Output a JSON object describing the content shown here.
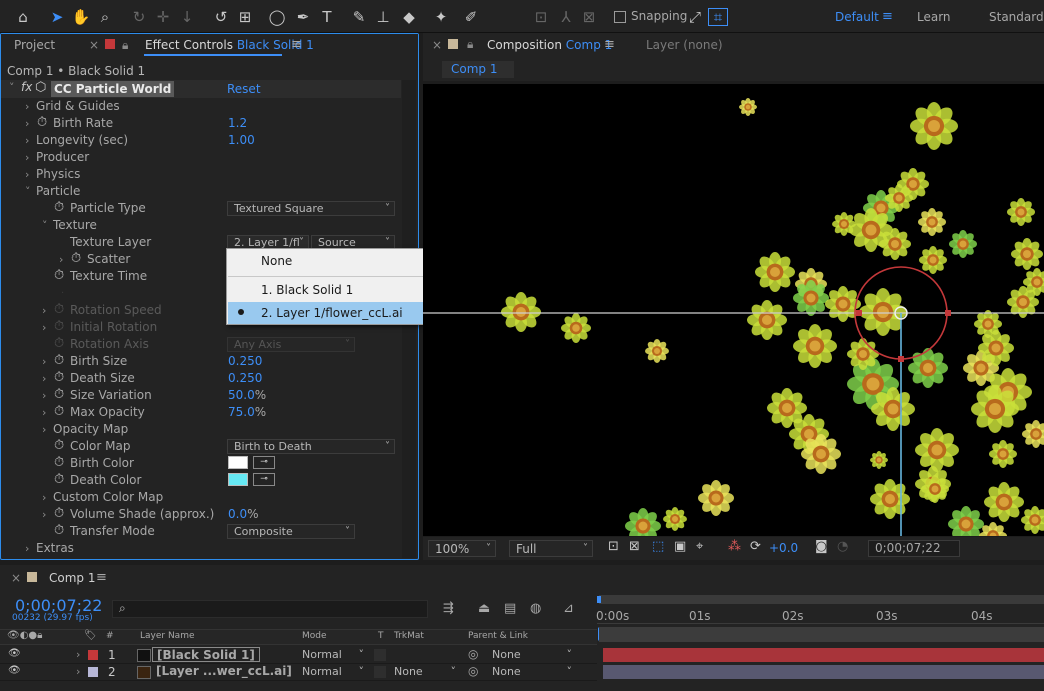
{
  "toolbar": {
    "snapping_label": "Snapping",
    "workspaces": [
      "Default",
      "Learn",
      "Standard"
    ]
  },
  "left_panel": {
    "project_tab": "Project",
    "effect_tab_prefix": "Effect Controls",
    "effect_tab_layer": "Black Solid 1",
    "breadcrumb": "Comp 1 • Black Solid 1",
    "effect_name": "CC Particle World",
    "reset_label": "Reset",
    "properties": [
      {
        "label": "Grid & Guides",
        "value": ""
      },
      {
        "label": "Birth Rate",
        "value": "1.2"
      },
      {
        "label": "Longevity (sec)",
        "value": "1.00"
      },
      {
        "label": "Producer",
        "value": ""
      },
      {
        "label": "Physics",
        "value": ""
      },
      {
        "label": "Particle",
        "value": ""
      },
      {
        "label": "Particle Type",
        "value": "Textured Square"
      },
      {
        "label": "Texture",
        "value": ""
      },
      {
        "label": "Texture Layer",
        "value": "2. Layer 1/fl",
        "value2": "Source"
      },
      {
        "label": "Scatter",
        "value": ""
      },
      {
        "label": "Texture Time",
        "value": ""
      },
      {
        "label": "Rotation Speed",
        "value": ""
      },
      {
        "label": "Initial Rotation",
        "value": ""
      },
      {
        "label": "Rotation Axis",
        "value": "Any Axis"
      },
      {
        "label": "Birth Size",
        "value": "0.250"
      },
      {
        "label": "Death Size",
        "value": "0.250"
      },
      {
        "label": "Size Variation",
        "value": "50.0",
        "unit": "%"
      },
      {
        "label": "Max Opacity",
        "value": "75.0",
        "unit": "%"
      },
      {
        "label": "Opacity Map",
        "value": ""
      },
      {
        "label": "Color Map",
        "value": "Birth to Death"
      },
      {
        "label": "Birth Color",
        "value": ""
      },
      {
        "label": "Death Color",
        "value": ""
      },
      {
        "label": "Custom Color Map",
        "value": ""
      },
      {
        "label": "Volume Shade (approx.)",
        "value": "0.0",
        "unit": "%"
      },
      {
        "label": "Transfer Mode",
        "value": "Composite"
      },
      {
        "label": "Extras",
        "value": ""
      }
    ],
    "colors": {
      "birth": "#ffffff",
      "death": "#66e9f4"
    }
  },
  "popup": {
    "items": [
      "None",
      "1. Black Solid 1",
      "2. Layer 1/flower_ccL.ai"
    ],
    "selected_index": 2
  },
  "composition": {
    "tab_prefix": "Composition",
    "tab_name": "Comp 1",
    "layer_tab": "Layer (none)",
    "subtab": "Comp 1",
    "zoom": "100%",
    "resolution": "Full",
    "exposure": "+0.0",
    "timecode": "0;00;07;22"
  },
  "timeline": {
    "tab": "Comp 1",
    "timecode": "0;00;07;22",
    "frames": "00232 (29.97 fps)",
    "search_placeholder": "",
    "ruler": [
      "0:00s",
      "01s",
      "02s",
      "03s",
      "04s"
    ],
    "headers": {
      "layer_name": "Layer Name",
      "mode": "Mode",
      "t": "T",
      "trkmat": "TrkMat",
      "parent": "Parent & Link"
    },
    "layers": [
      {
        "num": "1",
        "name": "[Black Solid 1]",
        "mode": "Normal",
        "trkmat": "",
        "parent": "None",
        "color": "#c4383a"
      },
      {
        "num": "2",
        "name": "[Layer ...wer_ccL.ai]",
        "mode": "Normal",
        "trkmat": "None",
        "parent": "None",
        "color": "#b8b8d8"
      }
    ]
  }
}
